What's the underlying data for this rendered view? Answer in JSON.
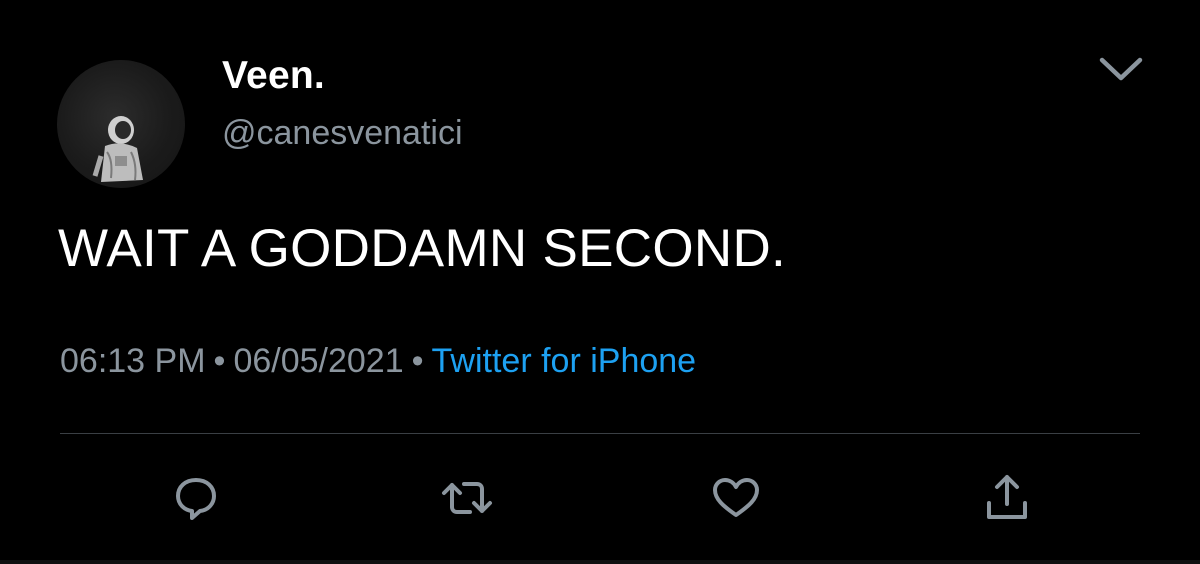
{
  "author": {
    "display_name": "Veen.",
    "handle": "@canesvenatici"
  },
  "tweet": {
    "text": "WAIT A GODDAMN SECOND."
  },
  "meta": {
    "time": "06:13 PM",
    "separator": "•",
    "date": "06/05/2021",
    "source": "Twitter for iPhone"
  },
  "actions": {
    "reply_icon": "reply-icon",
    "retweet_icon": "retweet-icon",
    "like_icon": "heart-icon",
    "share_icon": "share-icon",
    "menu_icon": "chevron-down-icon"
  },
  "colors": {
    "background": "#000000",
    "text": "#ffffff",
    "secondary": "#8b959e",
    "link": "#1da1f2"
  }
}
